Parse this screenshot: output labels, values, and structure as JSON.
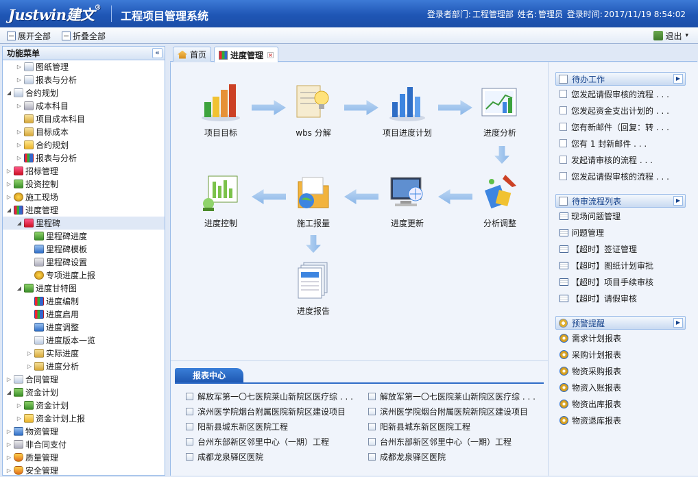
{
  "header": {
    "logo_text": "Justwin",
    "logo_cn": "建文",
    "logo_reg": "®",
    "app_title": "工程项目管理系统",
    "dept_label": "登录者部门:",
    "dept_value": "工程管理部",
    "name_label": "姓名:",
    "name_value": "管理员",
    "time_label": "登录时间:",
    "time_value": "2017/11/19 8:54:02"
  },
  "toolbar": {
    "expand_all": "展开全部",
    "collapse_all": "折叠全部",
    "exit": "退出",
    "exit_caret": "▾"
  },
  "left": {
    "title": "功能菜单",
    "collapse_glyph": "«",
    "tree": [
      {
        "label": "图纸管理",
        "level": 1,
        "toggle": "▷",
        "icon": "document-icon",
        "color": "c-doc"
      },
      {
        "label": "报表与分析",
        "level": 1,
        "toggle": "▷",
        "icon": "edit-document-icon",
        "color": "c-doc"
      },
      {
        "label": "合约规划",
        "level": 0,
        "toggle": "◢",
        "icon": "document-icon",
        "color": "c-doc"
      },
      {
        "label": "成本科目",
        "level": 1,
        "toggle": "▷",
        "icon": "box-icon",
        "color": "c-grey"
      },
      {
        "label": "项目成本科目",
        "level": 1,
        "toggle": "",
        "icon": "box-icon",
        "color": "c-box"
      },
      {
        "label": "目标成本",
        "level": 1,
        "toggle": "▷",
        "icon": "box-icon",
        "color": "c-box"
      },
      {
        "label": "合约规划",
        "level": 1,
        "toggle": "▷",
        "icon": "folder-icon",
        "color": "c-folder"
      },
      {
        "label": "报表与分析",
        "level": 1,
        "toggle": "▷",
        "icon": "bar-chart-icon",
        "color": "c-chart"
      },
      {
        "label": "招标管理",
        "level": 0,
        "toggle": "▷",
        "icon": "calendar-icon",
        "color": "c-red"
      },
      {
        "label": "投资控制",
        "level": 0,
        "toggle": "▷",
        "icon": "palette-icon",
        "color": "c-green"
      },
      {
        "label": "施工现场",
        "level": 0,
        "toggle": "▷",
        "icon": "euro-coin-icon",
        "color": "c-coin"
      },
      {
        "label": "进度管理",
        "level": 0,
        "toggle": "◢",
        "icon": "bar-chart-icon",
        "color": "c-chart"
      },
      {
        "label": "里程碑",
        "level": 1,
        "toggle": "◢",
        "icon": "milestone-icon",
        "color": "c-red",
        "selected": true
      },
      {
        "label": "里程碑进度",
        "level": 2,
        "toggle": "",
        "icon": "progress-icon",
        "color": "c-green"
      },
      {
        "label": "里程碑模板",
        "level": 2,
        "toggle": "",
        "icon": "template-icon",
        "color": "c-blue"
      },
      {
        "label": "里程碑设置",
        "level": 2,
        "toggle": "",
        "icon": "settings-icon",
        "color": "c-grey"
      },
      {
        "label": "专项进度上报",
        "level": 2,
        "toggle": "",
        "icon": "report-upload-icon",
        "color": "c-coin"
      },
      {
        "label": "进度甘特图",
        "level": 1,
        "toggle": "◢",
        "icon": "gantt-icon",
        "color": "c-green"
      },
      {
        "label": "进度编制",
        "level": 2,
        "toggle": "",
        "icon": "bar-chart-icon",
        "color": "c-chart"
      },
      {
        "label": "进度启用",
        "level": 2,
        "toggle": "",
        "icon": "bar-chart-icon",
        "color": "c-chart"
      },
      {
        "label": "进度调整",
        "level": 2,
        "toggle": "",
        "icon": "monitor-icon",
        "color": "c-blue"
      },
      {
        "label": "进度版本一览",
        "level": 2,
        "toggle": "",
        "icon": "document-icon",
        "color": "c-doc"
      },
      {
        "label": "实际进度",
        "level": 2,
        "toggle": "▷",
        "icon": "box-icon",
        "color": "c-box"
      },
      {
        "label": "进度分析",
        "level": 2,
        "toggle": "▷",
        "icon": "box-icon",
        "color": "c-box"
      },
      {
        "label": "合同管理",
        "level": 0,
        "toggle": "▷",
        "icon": "document-icon",
        "color": "c-doc"
      },
      {
        "label": "资金计划",
        "level": 0,
        "toggle": "◢",
        "icon": "money-icon",
        "color": "c-green"
      },
      {
        "label": "资金计划",
        "level": 1,
        "toggle": "▷",
        "icon": "yen-icon",
        "color": "c-green"
      },
      {
        "label": "资金计划上报",
        "level": 1,
        "toggle": "▷",
        "icon": "folder-icon",
        "color": "c-folder"
      },
      {
        "label": "物资管理",
        "level": 0,
        "toggle": "▷",
        "icon": "cube-icon",
        "color": "c-blue"
      },
      {
        "label": "非合同支付",
        "level": 0,
        "toggle": "▷",
        "icon": "grid-icon",
        "color": "c-grey"
      },
      {
        "label": "质量管理",
        "level": 0,
        "toggle": "▷",
        "icon": "shield-icon",
        "color": "c-shield"
      },
      {
        "label": "安全管理",
        "level": 0,
        "toggle": "▷",
        "icon": "shield-icon",
        "color": "c-shield"
      }
    ]
  },
  "tabs": [
    {
      "label": "首页",
      "icon": "home-icon"
    },
    {
      "label": "进度管理",
      "icon": "progress-chart-icon",
      "close": "×"
    }
  ],
  "flow": {
    "nodes": [
      {
        "label": "项目目标",
        "icon": "bar-chart-3d-icon"
      },
      {
        "label": "wbs 分解",
        "icon": "document-lightbulb-icon"
      },
      {
        "label": "项目进度计划",
        "icon": "blue-bar-chart-icon"
      },
      {
        "label": "进度分析",
        "icon": "analysis-chart-icon"
      },
      {
        "label": "进度控制",
        "icon": "control-panel-icon"
      },
      {
        "label": "施工报量",
        "icon": "folder-globe-icon"
      },
      {
        "label": "进度更新",
        "icon": "monitor-globe-icon"
      },
      {
        "label": "分析调整",
        "icon": "adjust-tool-icon"
      },
      {
        "label": "进度报告",
        "icon": "report-stack-icon"
      }
    ]
  },
  "report": {
    "title": "报表中心",
    "col1": [
      "解放军第一〇七医院莱山新院区医疗综 . . .",
      "滨州医学院烟台附属医院新院区建设项目",
      "阳新县城东新区医院工程",
      "台州东部新区邻里中心（一期）工程",
      "成都龙泉驿区医院"
    ],
    "col2": [
      "解放军第一〇七医院莱山新院区医疗综 . . .",
      "滨州医学院烟台附属医院新院区建设项目",
      "阳新县城东新区医院工程",
      "台州东部新区邻里中心（一期）工程",
      "成都龙泉驿区医院"
    ]
  },
  "todo": {
    "title": "待办工作",
    "more": "▶",
    "items": [
      "您发起请假审核的流程 . . .",
      "您发起资金支出计划的 . . .",
      "您有新邮件（回复：转 . . .",
      "您有 1 封新邮件 . . .",
      "发起请审核的流程 . . .",
      "您发起请假审核的流程 . . ."
    ]
  },
  "pending": {
    "title": "待审流程列表",
    "more": "▶",
    "items": [
      "现场问题管理",
      "问题管理",
      "【超时】签证管理",
      "【超时】图纸计划审批",
      "【超时】项目手续审核",
      "【超时】请假审核"
    ]
  },
  "warning": {
    "title": "预警提醒",
    "more": "▶",
    "items": [
      "需求计划报表",
      "采购计划报表",
      "物资采购报表",
      "物资入账报表",
      "物资出库报表",
      "物资退库报表"
    ]
  },
  "colors": {
    "header": "#1f56b5",
    "accent": "#2d6bc7",
    "panel_border": "#99bbe8",
    "background": "#dfe8f6"
  }
}
